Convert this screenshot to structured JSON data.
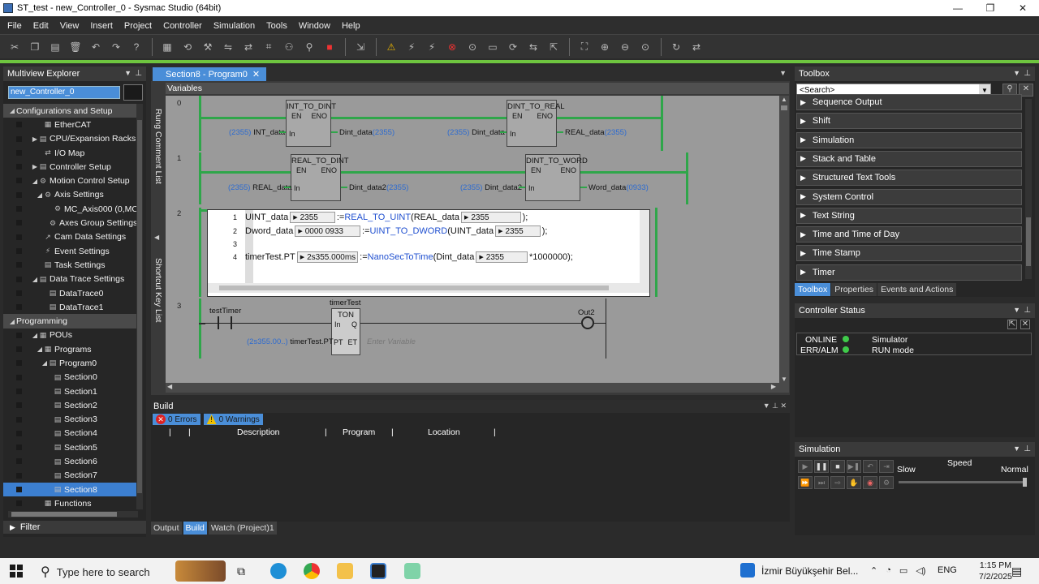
{
  "window": {
    "title": "ST_test - new_Controller_0 - Sysmac Studio (64bit)",
    "controls": [
      "—",
      "❐",
      "✕"
    ]
  },
  "menu": [
    "File",
    "Edit",
    "View",
    "Insert",
    "Project",
    "Controller",
    "Simulation",
    "Tools",
    "Window",
    "Help"
  ],
  "explorer": {
    "title": "Multiview Explorer",
    "controller": "new_Controller_0",
    "items": [
      {
        "label": "Configurations and Setup",
        "indent": 0,
        "twisty": "◢",
        "icon": "",
        "section": true
      },
      {
        "label": "EtherCAT",
        "indent": 2,
        "twisty": "",
        "icon": "▦"
      },
      {
        "label": "CPU/Expansion Racks",
        "indent": 1,
        "twisty": "▶",
        "icon": "▤"
      },
      {
        "label": "I/O Map",
        "indent": 2,
        "twisty": "",
        "icon": "⇄"
      },
      {
        "label": "Controller Setup",
        "indent": 1,
        "twisty": "▶",
        "icon": "▤"
      },
      {
        "label": "Motion Control Setup",
        "indent": 1,
        "twisty": "◢",
        "icon": "⚙"
      },
      {
        "label": "Axis Settings",
        "indent": 2,
        "twisty": "◢",
        "icon": "⚙"
      },
      {
        "label": "MC_Axis000 (0,MC",
        "indent": 4,
        "twisty": "",
        "icon": "⚙"
      },
      {
        "label": "Axes Group Settings",
        "indent": 3,
        "twisty": "",
        "icon": "⚙"
      },
      {
        "label": "Cam Data Settings",
        "indent": 2,
        "twisty": "",
        "icon": "↗"
      },
      {
        "label": "Event Settings",
        "indent": 2,
        "twisty": "",
        "icon": "⚡"
      },
      {
        "label": "Task Settings",
        "indent": 2,
        "twisty": "",
        "icon": "▤"
      },
      {
        "label": "Data Trace Settings",
        "indent": 1,
        "twisty": "◢",
        "icon": "▤"
      },
      {
        "label": "DataTrace0",
        "indent": 3,
        "twisty": "",
        "icon": "▤"
      },
      {
        "label": "DataTrace1",
        "indent": 3,
        "twisty": "",
        "icon": "▤"
      },
      {
        "label": "Programming",
        "indent": 0,
        "twisty": "◢",
        "icon": "",
        "section": true
      },
      {
        "label": "POUs",
        "indent": 1,
        "twisty": "◢",
        "icon": "▦"
      },
      {
        "label": "Programs",
        "indent": 2,
        "twisty": "◢",
        "icon": "▦"
      },
      {
        "label": "Program0",
        "indent": 3,
        "twisty": "◢",
        "icon": "▤"
      },
      {
        "label": "Section0",
        "indent": 4,
        "twisty": "",
        "icon": "▤"
      },
      {
        "label": "Section1",
        "indent": 4,
        "twisty": "",
        "icon": "▤"
      },
      {
        "label": "Section2",
        "indent": 4,
        "twisty": "",
        "icon": "▤"
      },
      {
        "label": "Section3",
        "indent": 4,
        "twisty": "",
        "icon": "▤"
      },
      {
        "label": "Section4",
        "indent": 4,
        "twisty": "",
        "icon": "▤"
      },
      {
        "label": "Section5",
        "indent": 4,
        "twisty": "",
        "icon": "▤"
      },
      {
        "label": "Section6",
        "indent": 4,
        "twisty": "",
        "icon": "▤"
      },
      {
        "label": "Section7",
        "indent": 4,
        "twisty": "",
        "icon": "▤"
      },
      {
        "label": "Section8",
        "indent": 4,
        "twisty": "",
        "icon": "▤",
        "selected": true
      },
      {
        "label": "Functions",
        "indent": 2,
        "twisty": "",
        "icon": "▦"
      }
    ],
    "filter": "Filter"
  },
  "editor": {
    "tab": "Section8 - Program0",
    "variables": "Variables",
    "side_labels": [
      "Rung Comment List",
      "Shortcut Key List"
    ],
    "rungs": {
      "r0": "0",
      "r1": "1",
      "r2": "2",
      "r3": "3",
      "fb_int_to_dint": "INT_TO_DINT",
      "fb_dint_to_real": "DINT_TO_REAL",
      "fb_real_to_dint": "REAL_TO_DINT",
      "fb_dint_to_word": "DINT_TO_WORD",
      "fb_ton": "TON",
      "en": "EN",
      "eno": "ENO",
      "in": "In",
      "v2355": "(2355)",
      "int_data": "INT_data",
      "dint_data": "Dint_data",
      "real_data": "REAL_data",
      "dint_data2": "Dint_data2",
      "word_data": "Word_data",
      "v0933": "(0933)",
      "test_timer": "testTimer",
      "timer_test": "timerTest",
      "out2": "Out2",
      "ton_in": "In",
      "ton_q": "Q",
      "ton_pt": "PT",
      "ton_et": "ET",
      "pt_val": "(2s355.00..)",
      "pt_var": "timerTest.PT",
      "enter_var": "Enter Variable"
    },
    "st": {
      "line1_num": "1",
      "line1_var": "UINT_data",
      "line1_val": "2355",
      "line1_op": ":=",
      "line1_fn": "REAL_TO_UINT",
      "line1_arg": "(REAL_data",
      "line1_argval": "2355",
      "line1_end": ");",
      "line2_num": "2",
      "line2_var": "Dword_data",
      "line2_val": "0000 0933",
      "line2_op": ":=",
      "line2_fn": "UINT_TO_DWORD",
      "line2_arg": "(UINT_data",
      "line2_argval": "2355",
      "line2_end": ");",
      "line3_num": "3",
      "line4_num": "4",
      "line4_var": "timerTest.PT",
      "line4_val": "2s355.000ms",
      "line4_op": ":=",
      "line4_fn": "NanoSecToTime",
      "line4_arg": "(Dint_data",
      "line4_argval": "2355",
      "line4_end": "*1000000);"
    }
  },
  "build": {
    "title": "Build",
    "errors": "0 Errors",
    "warnings": "0 Warnings",
    "columns": [
      "Description",
      "Program",
      "Location"
    ],
    "tabs": [
      "Output",
      "Build",
      "Watch (Project)1"
    ]
  },
  "toolbox": {
    "title": "Toolbox",
    "search_placeholder": "<Search>",
    "items": [
      "Sequence Output",
      "Shift",
      "Simulation",
      "Stack and Table",
      "Structured Text Tools",
      "System Control",
      "Text String",
      "Time and Time of Day",
      "Time Stamp",
      "Timer"
    ],
    "tabs": [
      "Toolbox",
      "Properties",
      "Events and Actions"
    ]
  },
  "controller_status": {
    "title": "Controller Status",
    "online": "ONLINE",
    "err": "ERR/ALM",
    "simulator": "Simulator",
    "mode": "RUN mode",
    "ok_color": "#3fca4a"
  },
  "simulation": {
    "title": "Simulation",
    "speed": "Speed",
    "slow": "Slow",
    "normal": "Normal"
  },
  "taskbar": {
    "search": "Type here to search",
    "weather": "İzmir Büyükşehir Bel...",
    "lang": "ENG",
    "time": "1:15 PM",
    "date": "7/2/2025"
  }
}
